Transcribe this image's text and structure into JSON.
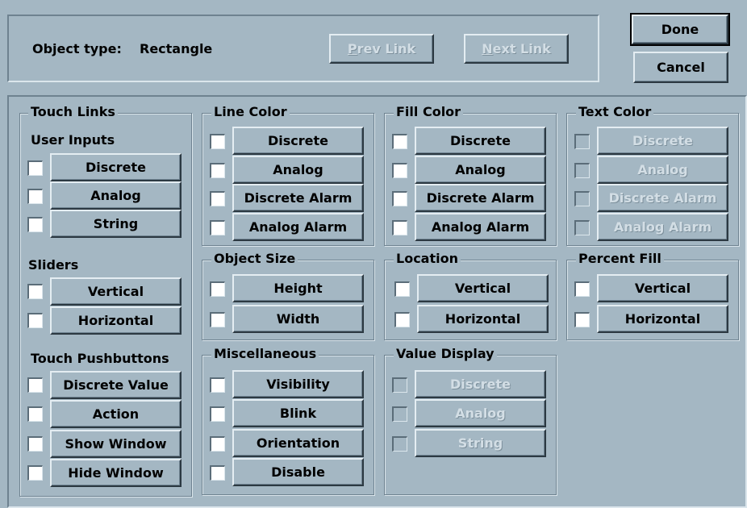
{
  "header": {
    "object_type_label": "Object type:",
    "object_type_value": "Rectangle",
    "prev_link": {
      "mnemonic": "P",
      "rest": "rev Link"
    },
    "next_link": {
      "mnemonic": "N",
      "rest": "ext Link"
    },
    "done_label": "Done",
    "cancel_label": "Cancel"
  },
  "touch_links": {
    "title": "Touch Links",
    "user_inputs": {
      "title": "User Inputs",
      "items": [
        "Discrete",
        "Analog",
        "String"
      ]
    },
    "sliders": {
      "title": "Sliders",
      "items": [
        "Vertical",
        "Horizontal"
      ]
    },
    "pushbuttons": {
      "title": "Touch Pushbuttons",
      "items": [
        "Discrete Value",
        "Action",
        "Show Window",
        "Hide Window"
      ]
    }
  },
  "line_color": {
    "title": "Line Color",
    "items": [
      "Discrete",
      "Analog",
      "Discrete Alarm",
      "Analog Alarm"
    ]
  },
  "fill_color": {
    "title": "Fill Color",
    "items": [
      "Discrete",
      "Analog",
      "Discrete Alarm",
      "Analog Alarm"
    ]
  },
  "text_color": {
    "title": "Text Color",
    "items": [
      "Discrete",
      "Analog",
      "Discrete Alarm",
      "Analog Alarm"
    ]
  },
  "object_size": {
    "title": "Object Size",
    "items": [
      "Height",
      "Width"
    ]
  },
  "location": {
    "title": "Location",
    "items": [
      "Vertical",
      "Horizontal"
    ]
  },
  "percent_fill": {
    "title": "Percent Fill",
    "items": [
      "Vertical",
      "Horizontal"
    ]
  },
  "miscellaneous": {
    "title": "Miscellaneous",
    "items": [
      "Visibility",
      "Blink",
      "Orientation",
      "Disable"
    ]
  },
  "value_display": {
    "title": "Value Display",
    "items": [
      "Discrete",
      "Analog",
      "String"
    ]
  }
}
